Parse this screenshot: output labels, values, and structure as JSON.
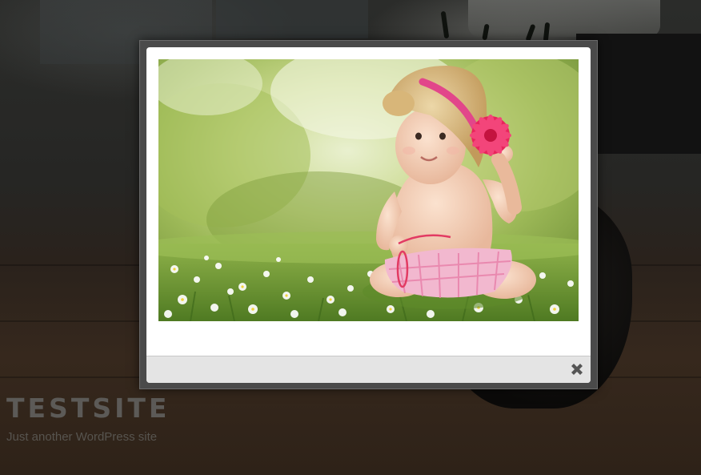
{
  "site": {
    "title": "TESTSITE",
    "tagline": "Just another WordPress site"
  },
  "lightbox": {
    "image_alt": "Baby in straw sun hat sitting in a daisy meadow",
    "close_icon": "close-icon"
  },
  "colors": {
    "overlay_frame": "#4a4a4a",
    "dialog_bg": "#ffffff",
    "footer_bg": "#e4e4e4",
    "close_icon": "#555555",
    "site_title": "#5c5a57"
  }
}
